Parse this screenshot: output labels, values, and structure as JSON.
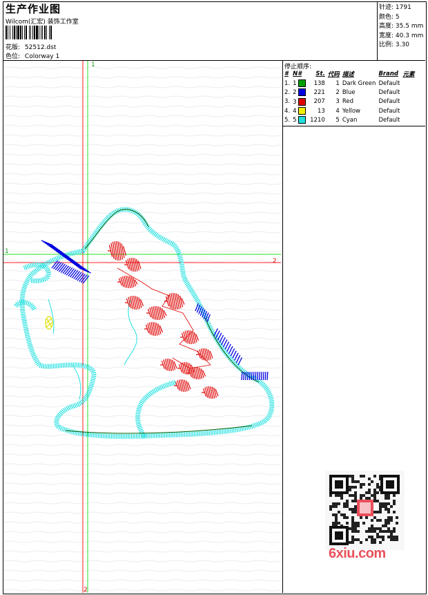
{
  "header": {
    "title": "生产作业图",
    "company": "Wilcom(汇宏) 装饰工作室",
    "design_label": "花版:",
    "design_value": "52512.dst",
    "colorway_label": "色位:",
    "colorway_value": "Colorway 1"
  },
  "stats": [
    {
      "label": "针迹:",
      "value": "1791"
    },
    {
      "label": "颜色:",
      "value": "5"
    },
    {
      "label": "高度:",
      "value": "35.5 mm"
    },
    {
      "label": "宽度:",
      "value": "40.3 mm"
    },
    {
      "label": "比例:",
      "value": "3.30"
    }
  ],
  "stop_sequence": {
    "title": "停止顺序:",
    "headers": [
      "#",
      "N#",
      "St.",
      "代码",
      "描述",
      "Brand",
      "元素"
    ],
    "rows": [
      {
        "idx": "1.",
        "n": "1",
        "color": "#00a000",
        "st": "138",
        "code": "1",
        "desc": "Dark Green",
        "brand": "Default"
      },
      {
        "idx": "2.",
        "n": "2",
        "color": "#0000e0",
        "st": "221",
        "code": "2",
        "desc": "Blue",
        "brand": "Default"
      },
      {
        "idx": "3.",
        "n": "3",
        "color": "#e00000",
        "st": "207",
        "code": "3",
        "desc": "Red",
        "brand": "Default"
      },
      {
        "idx": "4.",
        "n": "4",
        "color": "#f0f000",
        "st": "13",
        "code": "4",
        "desc": "Yellow",
        "brand": "Default"
      },
      {
        "idx": "5.",
        "n": "5",
        "color": "#20e0e0",
        "st": "1210",
        "code": "5",
        "desc": "Cyan",
        "brand": "Default"
      }
    ]
  },
  "axes": {
    "v_top": "1",
    "h_left": "1",
    "h_right": "2",
    "v_bottom": "2"
  },
  "watermark": {
    "logo": "6xiu.com"
  },
  "colors": {
    "cyan": "#20e0e0",
    "blue": "#0000e0",
    "red": "#e00000",
    "green": "#00a000",
    "yellow": "#f0f000",
    "guide_red": "#ff2020",
    "guide_green": "#20e020"
  }
}
